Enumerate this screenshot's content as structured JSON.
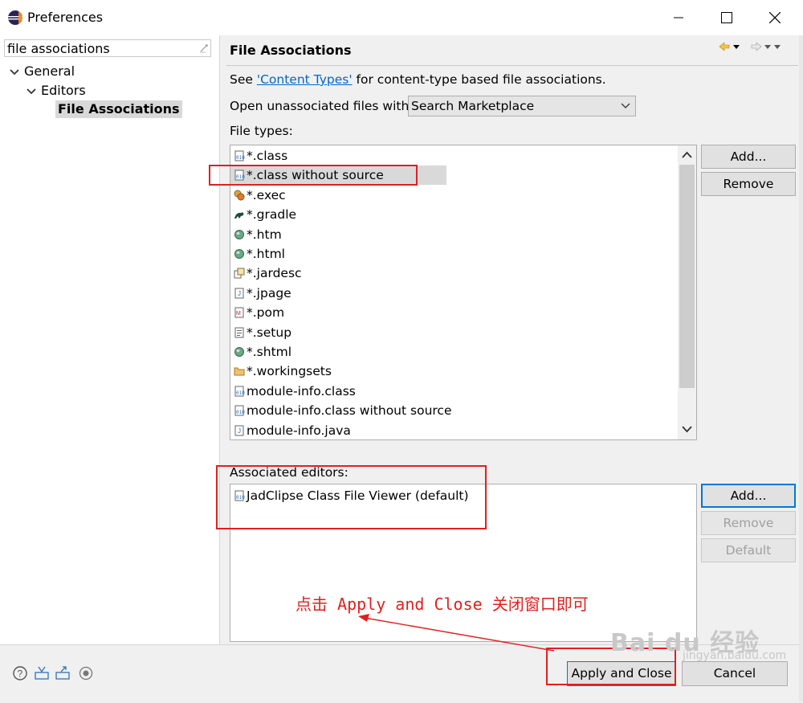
{
  "window": {
    "title": "Preferences"
  },
  "filter": {
    "value": "file associations"
  },
  "tree": {
    "general": "General",
    "editors": "Editors",
    "file_associations": "File Associations"
  },
  "page": {
    "title": "File Associations",
    "see_prefix": "See ",
    "see_link": "'Content Types'",
    "see_suffix": " for content-type based file associations.",
    "open_label": "Open unassociated files with:",
    "open_value": "Search Marketplace",
    "file_types_label": "File types:",
    "assoc_label": "Associated editors:"
  },
  "file_types": [
    {
      "label": "*.class",
      "icon": "class-file-icon"
    },
    {
      "label": "*.class without source",
      "icon": "class-file-icon",
      "selected": true
    },
    {
      "label": "*.exec",
      "icon": "exec-file-icon"
    },
    {
      "label": "*.gradle",
      "icon": "gradle-icon"
    },
    {
      "label": "*.htm",
      "icon": "web-file-icon"
    },
    {
      "label": "*.html",
      "icon": "web-file-icon"
    },
    {
      "label": "*.jardesc",
      "icon": "jardesc-icon"
    },
    {
      "label": "*.jpage",
      "icon": "jpage-icon"
    },
    {
      "label": "*.pom",
      "icon": "pom-icon"
    },
    {
      "label": "*.setup",
      "icon": "setup-icon"
    },
    {
      "label": "*.shtml",
      "icon": "web-file-icon"
    },
    {
      "label": "*.workingsets",
      "icon": "folder-icon"
    },
    {
      "label": "module-info.class",
      "icon": "class-file-icon"
    },
    {
      "label": "module-info.class without source",
      "icon": "class-file-icon"
    },
    {
      "label": "module-info.java",
      "icon": "java-file-icon"
    }
  ],
  "editors": [
    {
      "label": "JadClipse Class File Viewer (default)",
      "icon": "class-file-icon"
    }
  ],
  "buttons": {
    "ft_add": "Add...",
    "ft_remove": "Remove",
    "ed_add": "Add...",
    "ed_remove": "Remove",
    "ed_default": "Default",
    "apply_close": "Apply and Close",
    "cancel": "Cancel"
  },
  "annotation": "点击 Apply and Close 关闭窗口即可",
  "watermark": {
    "brand": "Bai du 经验",
    "url": "jingyan.baidu.com"
  },
  "colors": {
    "accent": "#0078d7",
    "annotation": "#e02020",
    "link": "#0066cc"
  }
}
